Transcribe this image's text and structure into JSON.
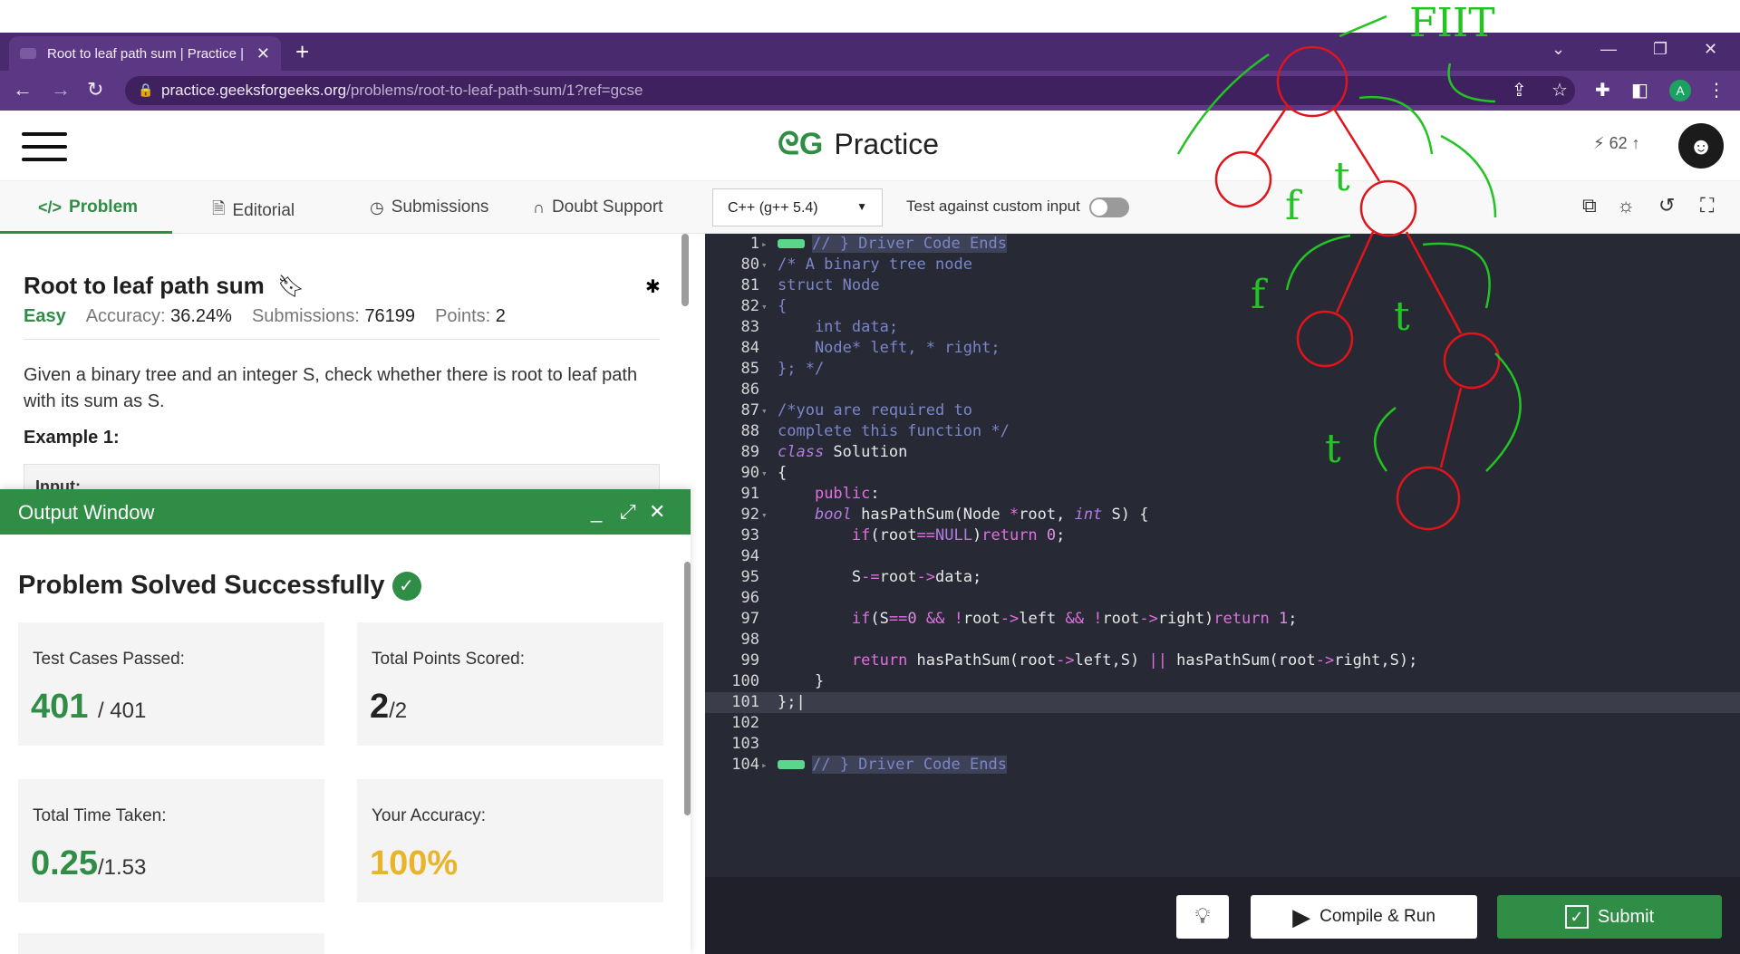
{
  "browser": {
    "tab_title": "Root to leaf path sum | Practice |",
    "url_host": "practice.geeksforgeeks.org",
    "url_path": "/problems/root-to-leaf-path-sum/1?ref=gcse",
    "profile_letter": "A"
  },
  "site": {
    "logo_word": "Practice",
    "streak": "62"
  },
  "tabs": [
    {
      "label": "Problem",
      "icon": "code-icon"
    },
    {
      "label": "Editorial",
      "icon": "document-icon"
    },
    {
      "label": "Submissions",
      "icon": "clock-icon"
    },
    {
      "label": "Doubt Support",
      "icon": "headset-icon"
    }
  ],
  "editor_toolbar": {
    "language": "C++ (g++ 5.4)",
    "custom_input_label": "Test against custom input"
  },
  "problem": {
    "title": "Root to leaf path sum",
    "difficulty": "Easy",
    "accuracy_label": "Accuracy:",
    "accuracy": "36.24%",
    "submissions_label": "Submissions:",
    "submissions": "76199",
    "points_label": "Points:",
    "points": "2",
    "description": "Given a binary tree and an integer S, check whether there is root to leaf path with its sum as S.",
    "example_heading": "Example 1:",
    "input_label": "Input:"
  },
  "output": {
    "title": "Output Window",
    "status": "Problem Solved Successfully",
    "tests_label": "Test Cases Passed:",
    "tests_passed": "401",
    "tests_total": "/ 401",
    "points_label": "Total Points Scored:",
    "points_scored": "2",
    "points_total": "/2",
    "time_label": "Total Time Taken:",
    "time_taken": "0.25",
    "time_limit": "/1.53",
    "accuracy_label": "Your Accuracy:",
    "accuracy": "100%"
  },
  "buttons": {
    "compile_run": "Compile & Run",
    "submit": "Submit"
  },
  "code_lines": {
    "l1": "// } Driver Code Ends",
    "l80": "/* A binary tree node",
    "l81": "struct Node",
    "l82": "{",
    "l83": "    int data;",
    "l84": "    Node* left, * right;",
    "l85": "}; */",
    "l87": "/*you are required to",
    "l88": "complete this function */",
    "l104": "// } Driver Code Ends"
  },
  "annotations": {
    "top_note": "FIIT",
    "labels": [
      "f",
      "t",
      "f",
      "t",
      "t"
    ]
  },
  "colors": {
    "brand_green": "#2f8d46",
    "browser_purple": "#5b3784",
    "editor_bg": "#272935",
    "accuracy_gold": "#e8b52a",
    "sketch_red": "#e0151c",
    "sketch_green": "#22c322"
  }
}
